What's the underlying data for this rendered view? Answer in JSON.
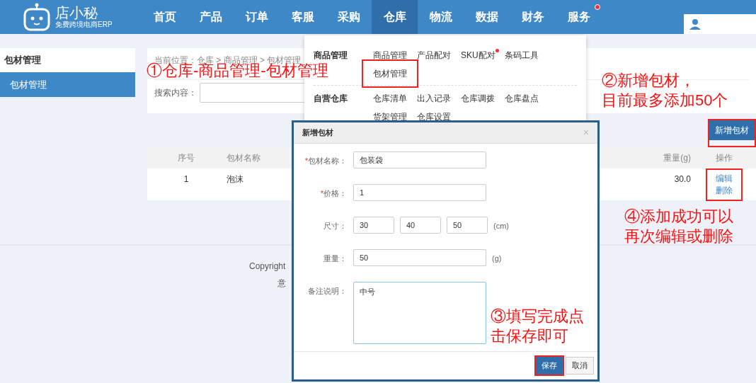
{
  "logo": {
    "name": "店小秘",
    "tagline": "免费跨境电商ERP"
  },
  "nav": [
    {
      "label": "首页",
      "selected": false,
      "dot": false
    },
    {
      "label": "产品",
      "selected": false,
      "dot": false
    },
    {
      "label": "订单",
      "selected": false,
      "dot": false
    },
    {
      "label": "客服",
      "selected": false,
      "dot": false
    },
    {
      "label": "采购",
      "selected": false,
      "dot": false
    },
    {
      "label": "仓库",
      "selected": true,
      "dot": false
    },
    {
      "label": "物流",
      "selected": false,
      "dot": false
    },
    {
      "label": "数据",
      "selected": false,
      "dot": false
    },
    {
      "label": "财务",
      "selected": false,
      "dot": false
    },
    {
      "label": "服务",
      "selected": false,
      "dot": true
    }
  ],
  "dropdown": [
    {
      "group": "商品管理",
      "items": [
        {
          "label": "商品管理",
          "dot": false,
          "highlighted": false
        },
        {
          "label": "产品配对",
          "dot": false,
          "highlighted": false
        },
        {
          "label": "SKU配对",
          "dot": true,
          "highlighted": false
        },
        {
          "label": "条码工具",
          "dot": false,
          "highlighted": false
        },
        {
          "label": "包材管理",
          "dot": false,
          "highlighted": true
        }
      ]
    },
    {
      "group": "自营仓库",
      "items": [
        {
          "label": "仓库清单",
          "dot": false,
          "highlighted": false
        },
        {
          "label": "出入记录",
          "dot": false,
          "highlighted": false
        },
        {
          "label": "仓库调拨",
          "dot": false,
          "highlighted": false
        },
        {
          "label": "仓库盘点",
          "dot": false,
          "highlighted": false
        },
        {
          "label": "货架管理",
          "dot": false,
          "highlighted": false
        },
        {
          "label": "仓库设置",
          "dot": false,
          "highlighted": false
        }
      ]
    }
  ],
  "sidebar": {
    "title": "包材管理",
    "items": [
      {
        "label": "包材管理",
        "selected": true
      }
    ]
  },
  "breadcrumb": "当前位置：仓库 > 商品管理 > 包材管理",
  "search": {
    "label": "搜索内容："
  },
  "add_button": {
    "label": "新增包材",
    "highlighted": true
  },
  "table": {
    "columns": [
      "序号",
      "包材名称",
      "重量(g)",
      "操作"
    ],
    "rows": [
      {
        "index": "1",
        "name": "泡沫",
        "weight": "30.0",
        "actions": [
          "编辑",
          "删除"
        ],
        "highlighted": true
      }
    ]
  },
  "footer": [
    "Copyright",
    "意"
  ],
  "dialog": {
    "title": "新增包材",
    "close": "×",
    "fields": [
      {
        "kind": "text",
        "mark": "*",
        "label": "包材名称：",
        "values": [
          "包装袋"
        ]
      },
      {
        "kind": "text",
        "mark": "*",
        "label": "价格：",
        "values": [
          "1"
        ]
      },
      {
        "kind": "triple",
        "label": "尺寸：",
        "values": [
          "30",
          "40",
          "50"
        ],
        "unit": "(cm)"
      },
      {
        "kind": "text",
        "label": "重量：",
        "values": [
          "50"
        ],
        "unit": "(g)"
      },
      {
        "kind": "textarea",
        "label": "备注说明：",
        "values": [
          "中号"
        ]
      }
    ],
    "buttons": [
      {
        "label": "保存",
        "kind": "primary",
        "highlighted": true
      },
      {
        "label": "取消",
        "kind": "default",
        "highlighted": false
      }
    ]
  },
  "annotations": [
    [
      "①仓库-商品管理-包材管理"
    ],
    [
      "②新增包材，",
      "目前最多添加50个"
    ],
    [
      "③填写完成点",
      "击保存即可"
    ],
    [
      "④添加成功可以",
      "再次编辑或删除"
    ]
  ]
}
